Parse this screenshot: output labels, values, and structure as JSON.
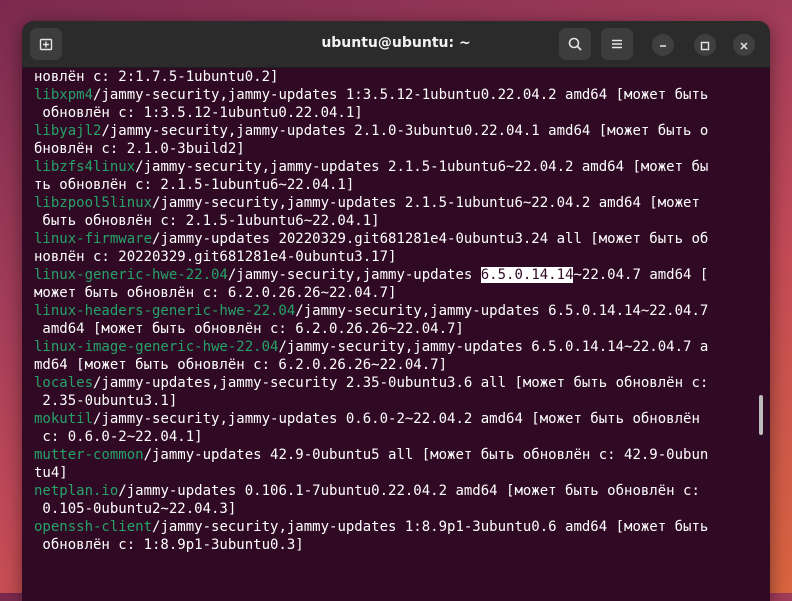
{
  "window": {
    "title": "ubuntu@ubuntu: ~",
    "icons": {
      "new_tab": "new-tab-icon",
      "search": "search-icon",
      "menu": "hamburger-menu-icon",
      "minimize": "minimize-icon",
      "maximize": "maximize-icon",
      "close": "close-icon"
    }
  },
  "colors": {
    "terminal_bg": "#300a24",
    "package_name": "#26a269",
    "text": "#ffffff",
    "selection_bg": "#ffffff",
    "headerbar": "#2b2b2b"
  },
  "terminal": {
    "lines": [
      {
        "pre": "",
        "pkg": "",
        "rest": "новлён с: 2:1.7.5-1ubuntu0.2]"
      },
      {
        "pre": "",
        "pkg": "libxpm4",
        "rest": "/jammy-security,jammy-updates 1:3.5.12-1ubuntu0.22.04.2 amd64 [может быть"
      },
      {
        "pre": "",
        "pkg": "",
        "rest": " обновлён с: 1:3.5.12-1ubuntu0.22.04.1]"
      },
      {
        "pre": "",
        "pkg": "libyajl2",
        "rest": "/jammy-security,jammy-updates 2.1.0-3ubuntu0.22.04.1 amd64 [может быть о"
      },
      {
        "pre": "",
        "pkg": "",
        "rest": "бновлён с: 2.1.0-3build2]"
      },
      {
        "pre": "",
        "pkg": "libzfs4linux",
        "rest": "/jammy-security,jammy-updates 2.1.5-1ubuntu6~22.04.2 amd64 [может бы"
      },
      {
        "pre": "",
        "pkg": "",
        "rest": "ть обновлён с: 2.1.5-1ubuntu6~22.04.1]"
      },
      {
        "pre": "",
        "pkg": "libzpool5linux",
        "rest": "/jammy-security,jammy-updates 2.1.5-1ubuntu6~22.04.2 amd64 [может"
      },
      {
        "pre": "",
        "pkg": "",
        "rest": " быть обновлён с: 2.1.5-1ubuntu6~22.04.1]"
      },
      {
        "pre": "",
        "pkg": "linux-firmware",
        "rest": "/jammy-updates 20220329.git681281e4-0ubuntu3.24 all [может быть об"
      },
      {
        "pre": "",
        "pkg": "",
        "rest": "новлён с: 20220329.git681281e4-0ubuntu3.17]"
      },
      {
        "pre": "",
        "pkg": "linux-generic-hwe-22.04",
        "rest": "/jammy-security,jammy-updates ",
        "selected": "6.5.0.14.14",
        "after": "~22.04.7 amd64 ["
      },
      {
        "pre": "",
        "pkg": "",
        "rest": "может быть обновлён с: 6.2.0.26.26~22.04.7]"
      },
      {
        "pre": "",
        "pkg": "linux-headers-generic-hwe-22.04",
        "rest": "/jammy-security,jammy-updates 6.5.0.14.14~22.04.7"
      },
      {
        "pre": "",
        "pkg": "",
        "rest": " amd64 [может быть обновлён с: 6.2.0.26.26~22.04.7]"
      },
      {
        "pre": "",
        "pkg": "linux-image-generic-hwe-22.04",
        "rest": "/jammy-security,jammy-updates 6.5.0.14.14~22.04.7 a"
      },
      {
        "pre": "",
        "pkg": "",
        "rest": "md64 [может быть обновлён с: 6.2.0.26.26~22.04.7]"
      },
      {
        "pre": "",
        "pkg": "locales",
        "rest": "/jammy-updates,jammy-security 2.35-0ubuntu3.6 all [может быть обновлён с:"
      },
      {
        "pre": "",
        "pkg": "",
        "rest": " 2.35-0ubuntu3.1]"
      },
      {
        "pre": "",
        "pkg": "mokutil",
        "rest": "/jammy-security,jammy-updates 0.6.0-2~22.04.2 amd64 [может быть обновлён"
      },
      {
        "pre": "",
        "pkg": "",
        "rest": " с: 0.6.0-2~22.04.1]"
      },
      {
        "pre": "",
        "pkg": "mutter-common",
        "rest": "/jammy-updates 42.9-0ubuntu5 all [может быть обновлён с: 42.9-0ubun"
      },
      {
        "pre": "",
        "pkg": "",
        "rest": "tu4]"
      },
      {
        "pre": "",
        "pkg": "netplan.io",
        "rest": "/jammy-updates 0.106.1-7ubuntu0.22.04.2 amd64 [может быть обновлён с:"
      },
      {
        "pre": "",
        "pkg": "",
        "rest": " 0.105-0ubuntu2~22.04.3]"
      },
      {
        "pre": "",
        "pkg": "openssh-client",
        "rest": "/jammy-security,jammy-updates 1:8.9p1-3ubuntu0.6 amd64 [может быть"
      },
      {
        "pre": "",
        "pkg": "",
        "rest": " обновлён с: 1:8.9p1-3ubuntu0.3]"
      }
    ]
  }
}
